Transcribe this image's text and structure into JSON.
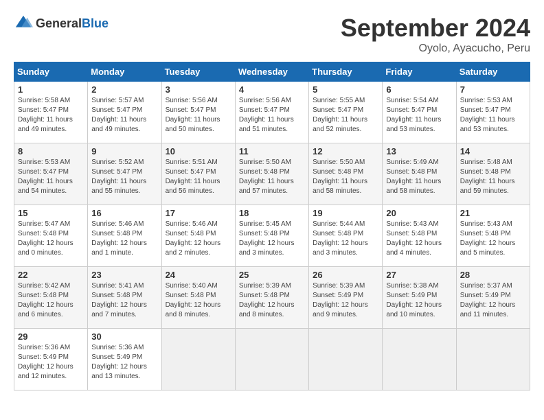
{
  "header": {
    "logo_general": "General",
    "logo_blue": "Blue",
    "month_title": "September 2024",
    "location": "Oyolo, Ayacucho, Peru"
  },
  "days_of_week": [
    "Sunday",
    "Monday",
    "Tuesday",
    "Wednesday",
    "Thursday",
    "Friday",
    "Saturday"
  ],
  "weeks": [
    [
      {
        "num": "1",
        "info": "Sunrise: 5:58 AM\nSunset: 5:47 PM\nDaylight: 11 hours\nand 49 minutes."
      },
      {
        "num": "2",
        "info": "Sunrise: 5:57 AM\nSunset: 5:47 PM\nDaylight: 11 hours\nand 49 minutes."
      },
      {
        "num": "3",
        "info": "Sunrise: 5:56 AM\nSunset: 5:47 PM\nDaylight: 11 hours\nand 50 minutes."
      },
      {
        "num": "4",
        "info": "Sunrise: 5:56 AM\nSunset: 5:47 PM\nDaylight: 11 hours\nand 51 minutes."
      },
      {
        "num": "5",
        "info": "Sunrise: 5:55 AM\nSunset: 5:47 PM\nDaylight: 11 hours\nand 52 minutes."
      },
      {
        "num": "6",
        "info": "Sunrise: 5:54 AM\nSunset: 5:47 PM\nDaylight: 11 hours\nand 53 minutes."
      },
      {
        "num": "7",
        "info": "Sunrise: 5:53 AM\nSunset: 5:47 PM\nDaylight: 11 hours\nand 53 minutes."
      }
    ],
    [
      {
        "num": "8",
        "info": "Sunrise: 5:53 AM\nSunset: 5:47 PM\nDaylight: 11 hours\nand 54 minutes."
      },
      {
        "num": "9",
        "info": "Sunrise: 5:52 AM\nSunset: 5:47 PM\nDaylight: 11 hours\nand 55 minutes."
      },
      {
        "num": "10",
        "info": "Sunrise: 5:51 AM\nSunset: 5:47 PM\nDaylight: 11 hours\nand 56 minutes."
      },
      {
        "num": "11",
        "info": "Sunrise: 5:50 AM\nSunset: 5:48 PM\nDaylight: 11 hours\nand 57 minutes."
      },
      {
        "num": "12",
        "info": "Sunrise: 5:50 AM\nSunset: 5:48 PM\nDaylight: 11 hours\nand 58 minutes."
      },
      {
        "num": "13",
        "info": "Sunrise: 5:49 AM\nSunset: 5:48 PM\nDaylight: 11 hours\nand 58 minutes."
      },
      {
        "num": "14",
        "info": "Sunrise: 5:48 AM\nSunset: 5:48 PM\nDaylight: 11 hours\nand 59 minutes."
      }
    ],
    [
      {
        "num": "15",
        "info": "Sunrise: 5:47 AM\nSunset: 5:48 PM\nDaylight: 12 hours\nand 0 minutes."
      },
      {
        "num": "16",
        "info": "Sunrise: 5:46 AM\nSunset: 5:48 PM\nDaylight: 12 hours\nand 1 minute."
      },
      {
        "num": "17",
        "info": "Sunrise: 5:46 AM\nSunset: 5:48 PM\nDaylight: 12 hours\nand 2 minutes."
      },
      {
        "num": "18",
        "info": "Sunrise: 5:45 AM\nSunset: 5:48 PM\nDaylight: 12 hours\nand 3 minutes."
      },
      {
        "num": "19",
        "info": "Sunrise: 5:44 AM\nSunset: 5:48 PM\nDaylight: 12 hours\nand 3 minutes."
      },
      {
        "num": "20",
        "info": "Sunrise: 5:43 AM\nSunset: 5:48 PM\nDaylight: 12 hours\nand 4 minutes."
      },
      {
        "num": "21",
        "info": "Sunrise: 5:43 AM\nSunset: 5:48 PM\nDaylight: 12 hours\nand 5 minutes."
      }
    ],
    [
      {
        "num": "22",
        "info": "Sunrise: 5:42 AM\nSunset: 5:48 PM\nDaylight: 12 hours\nand 6 minutes."
      },
      {
        "num": "23",
        "info": "Sunrise: 5:41 AM\nSunset: 5:48 PM\nDaylight: 12 hours\nand 7 minutes."
      },
      {
        "num": "24",
        "info": "Sunrise: 5:40 AM\nSunset: 5:48 PM\nDaylight: 12 hours\nand 8 minutes."
      },
      {
        "num": "25",
        "info": "Sunrise: 5:39 AM\nSunset: 5:48 PM\nDaylight: 12 hours\nand 8 minutes."
      },
      {
        "num": "26",
        "info": "Sunrise: 5:39 AM\nSunset: 5:49 PM\nDaylight: 12 hours\nand 9 minutes."
      },
      {
        "num": "27",
        "info": "Sunrise: 5:38 AM\nSunset: 5:49 PM\nDaylight: 12 hours\nand 10 minutes."
      },
      {
        "num": "28",
        "info": "Sunrise: 5:37 AM\nSunset: 5:49 PM\nDaylight: 12 hours\nand 11 minutes."
      }
    ],
    [
      {
        "num": "29",
        "info": "Sunrise: 5:36 AM\nSunset: 5:49 PM\nDaylight: 12 hours\nand 12 minutes."
      },
      {
        "num": "30",
        "info": "Sunrise: 5:36 AM\nSunset: 5:49 PM\nDaylight: 12 hours\nand 13 minutes."
      },
      {
        "num": "",
        "info": ""
      },
      {
        "num": "",
        "info": ""
      },
      {
        "num": "",
        "info": ""
      },
      {
        "num": "",
        "info": ""
      },
      {
        "num": "",
        "info": ""
      }
    ]
  ]
}
